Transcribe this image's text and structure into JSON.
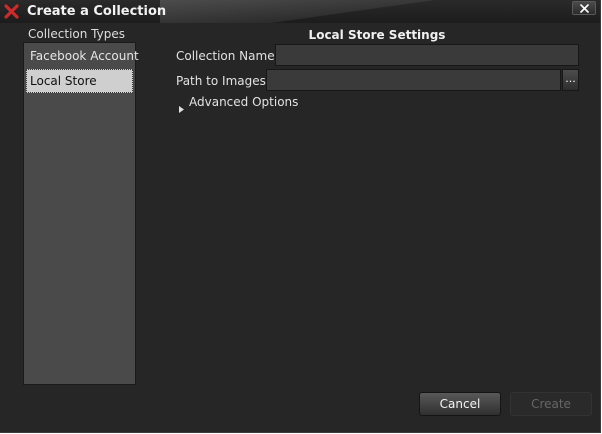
{
  "window": {
    "title": "Create a Collection",
    "app_icon": "red-x-icon",
    "close_icon": "close-icon"
  },
  "sidebar": {
    "label": "Collection Types",
    "items": [
      {
        "label": "Facebook Account",
        "selected": false
      },
      {
        "label": "Local Store",
        "selected": true
      }
    ]
  },
  "settings": {
    "heading": "Local Store Settings",
    "collection_name": {
      "label": "Collection Name:",
      "value": ""
    },
    "path_to_images": {
      "label": "Path to Images:",
      "value": "",
      "browse_label": "..."
    },
    "advanced": {
      "label": "Advanced Options",
      "expanded": false,
      "icon": "triangle-right-icon"
    }
  },
  "footer": {
    "cancel_label": "Cancel",
    "create_label": "Create",
    "create_enabled": false
  },
  "colors": {
    "window_bg": "#262626",
    "icon_red": "#cc2b2b",
    "selected_item_bg": "#cfcfcf"
  }
}
